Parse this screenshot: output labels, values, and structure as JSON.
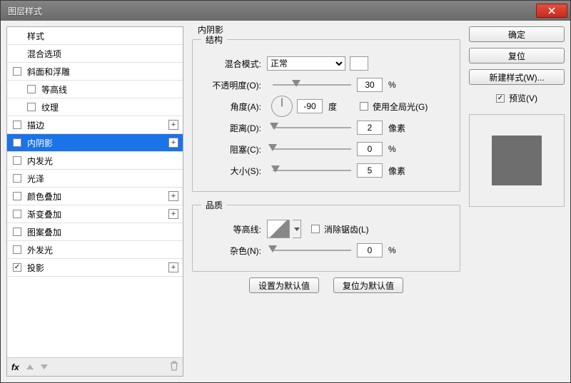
{
  "window": {
    "title": "图层样式"
  },
  "sidebar": {
    "header_styles": "样式",
    "header_blend": "混合选项",
    "items": [
      {
        "label": "斜面和浮雕",
        "checked": false,
        "indent": false,
        "plus": false
      },
      {
        "label": "等高线",
        "checked": false,
        "indent": true,
        "plus": false
      },
      {
        "label": "纹理",
        "checked": false,
        "indent": true,
        "plus": false
      },
      {
        "label": "描边",
        "checked": false,
        "indent": false,
        "plus": true
      },
      {
        "label": "内阴影",
        "checked": true,
        "indent": false,
        "plus": true,
        "selected": true
      },
      {
        "label": "内发光",
        "checked": false,
        "indent": false,
        "plus": false
      },
      {
        "label": "光泽",
        "checked": false,
        "indent": false,
        "plus": false
      },
      {
        "label": "颜色叠加",
        "checked": false,
        "indent": false,
        "plus": true
      },
      {
        "label": "渐变叠加",
        "checked": false,
        "indent": false,
        "plus": true
      },
      {
        "label": "图案叠加",
        "checked": false,
        "indent": false,
        "plus": false
      },
      {
        "label": "外发光",
        "checked": false,
        "indent": false,
        "plus": false
      },
      {
        "label": "投影",
        "checked": true,
        "indent": false,
        "plus": true
      }
    ],
    "fx": "fx"
  },
  "main": {
    "title": "内阴影",
    "structure": {
      "legend": "结构",
      "blend_mode_label": "混合模式:",
      "blend_mode_value": "正常",
      "opacity_label": "不透明度(O):",
      "opacity_value": "30",
      "opacity_unit": "%",
      "angle_label": "角度(A):",
      "angle_value": "-90",
      "angle_unit": "度",
      "global_light_label": "使用全局光(G)",
      "distance_label": "距离(D):",
      "distance_value": "2",
      "distance_unit": "像素",
      "choke_label": "阻塞(C):",
      "choke_value": "0",
      "choke_unit": "%",
      "size_label": "大小(S):",
      "size_value": "5",
      "size_unit": "像素"
    },
    "quality": {
      "legend": "品质",
      "contour_label": "等高线:",
      "antialias_label": "消除锯齿(L)",
      "noise_label": "杂色(N):",
      "noise_value": "0",
      "noise_unit": "%"
    },
    "buttons": {
      "set_default": "设置为默认值",
      "reset_default": "复位为默认值"
    }
  },
  "right": {
    "ok": "确定",
    "reset": "复位",
    "new_style": "新建样式(W)...",
    "preview": "预览(V)"
  }
}
